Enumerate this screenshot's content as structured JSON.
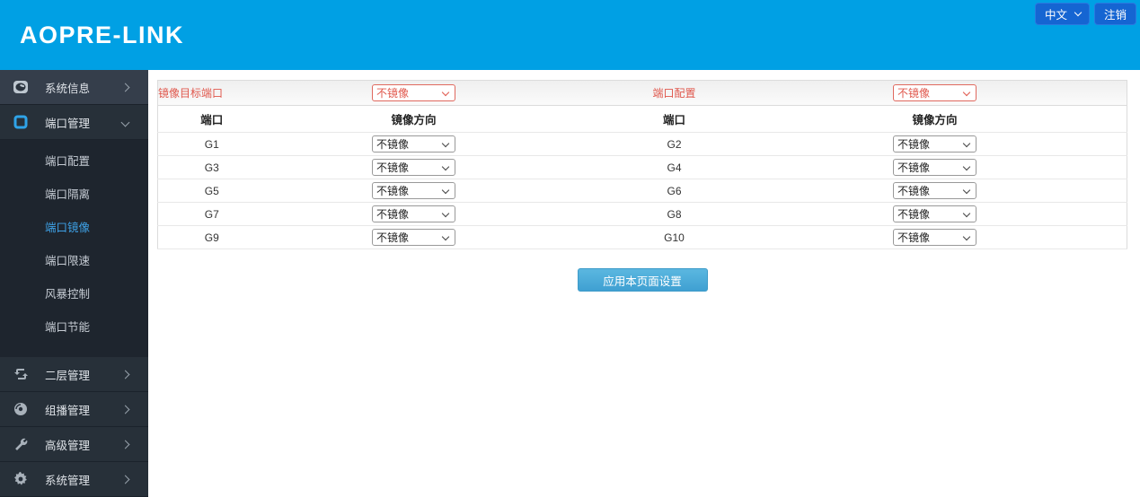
{
  "header": {
    "logo": "AOPRE-LINK",
    "language": "中文",
    "logout": "注销"
  },
  "colors": {
    "header_blue": "#00A0E4",
    "top_button_blue": "#1565D2",
    "sidebar_dark": "#252E39",
    "active_link_blue": "#3EA1E6",
    "label_red": "#E0584D",
    "apply_blue": "#48A8D8"
  },
  "sidebar": {
    "items": [
      {
        "label": "系统信息",
        "state": "collapsed"
      },
      {
        "label": "端口管理",
        "state": "expanded",
        "children": [
          {
            "label": "端口配置",
            "active": false
          },
          {
            "label": "端口隔离",
            "active": false
          },
          {
            "label": "端口镜像",
            "active": true
          },
          {
            "label": "端口限速",
            "active": false
          },
          {
            "label": "风暴控制",
            "active": false
          },
          {
            "label": "端口节能",
            "active": false
          }
        ]
      },
      {
        "label": "二层管理",
        "state": "collapsed"
      },
      {
        "label": "组播管理",
        "state": "collapsed"
      },
      {
        "label": "高级管理",
        "state": "collapsed"
      },
      {
        "label": "系统管理",
        "state": "collapsed"
      }
    ]
  },
  "content": {
    "config": {
      "mirror_target_label": "镜像目标端口",
      "mirror_target_value": "不镜像",
      "port_config_label": "端口配置",
      "port_config_value": "不镜像"
    },
    "table": {
      "headers": [
        "端口",
        "镜像方向",
        "端口",
        "镜像方向"
      ],
      "rows": [
        {
          "left_port": "G1",
          "left_dir": "不镜像",
          "right_port": "G2",
          "right_dir": "不镜像"
        },
        {
          "left_port": "G3",
          "left_dir": "不镜像",
          "right_port": "G4",
          "right_dir": "不镜像"
        },
        {
          "left_port": "G5",
          "left_dir": "不镜像",
          "right_port": "G6",
          "right_dir": "不镜像"
        },
        {
          "left_port": "G7",
          "left_dir": "不镜像",
          "right_port": "G8",
          "right_dir": "不镜像"
        },
        {
          "left_port": "G9",
          "left_dir": "不镜像",
          "right_port": "G10",
          "right_dir": "不镜像"
        }
      ]
    },
    "apply_label": "应用本页面设置"
  }
}
